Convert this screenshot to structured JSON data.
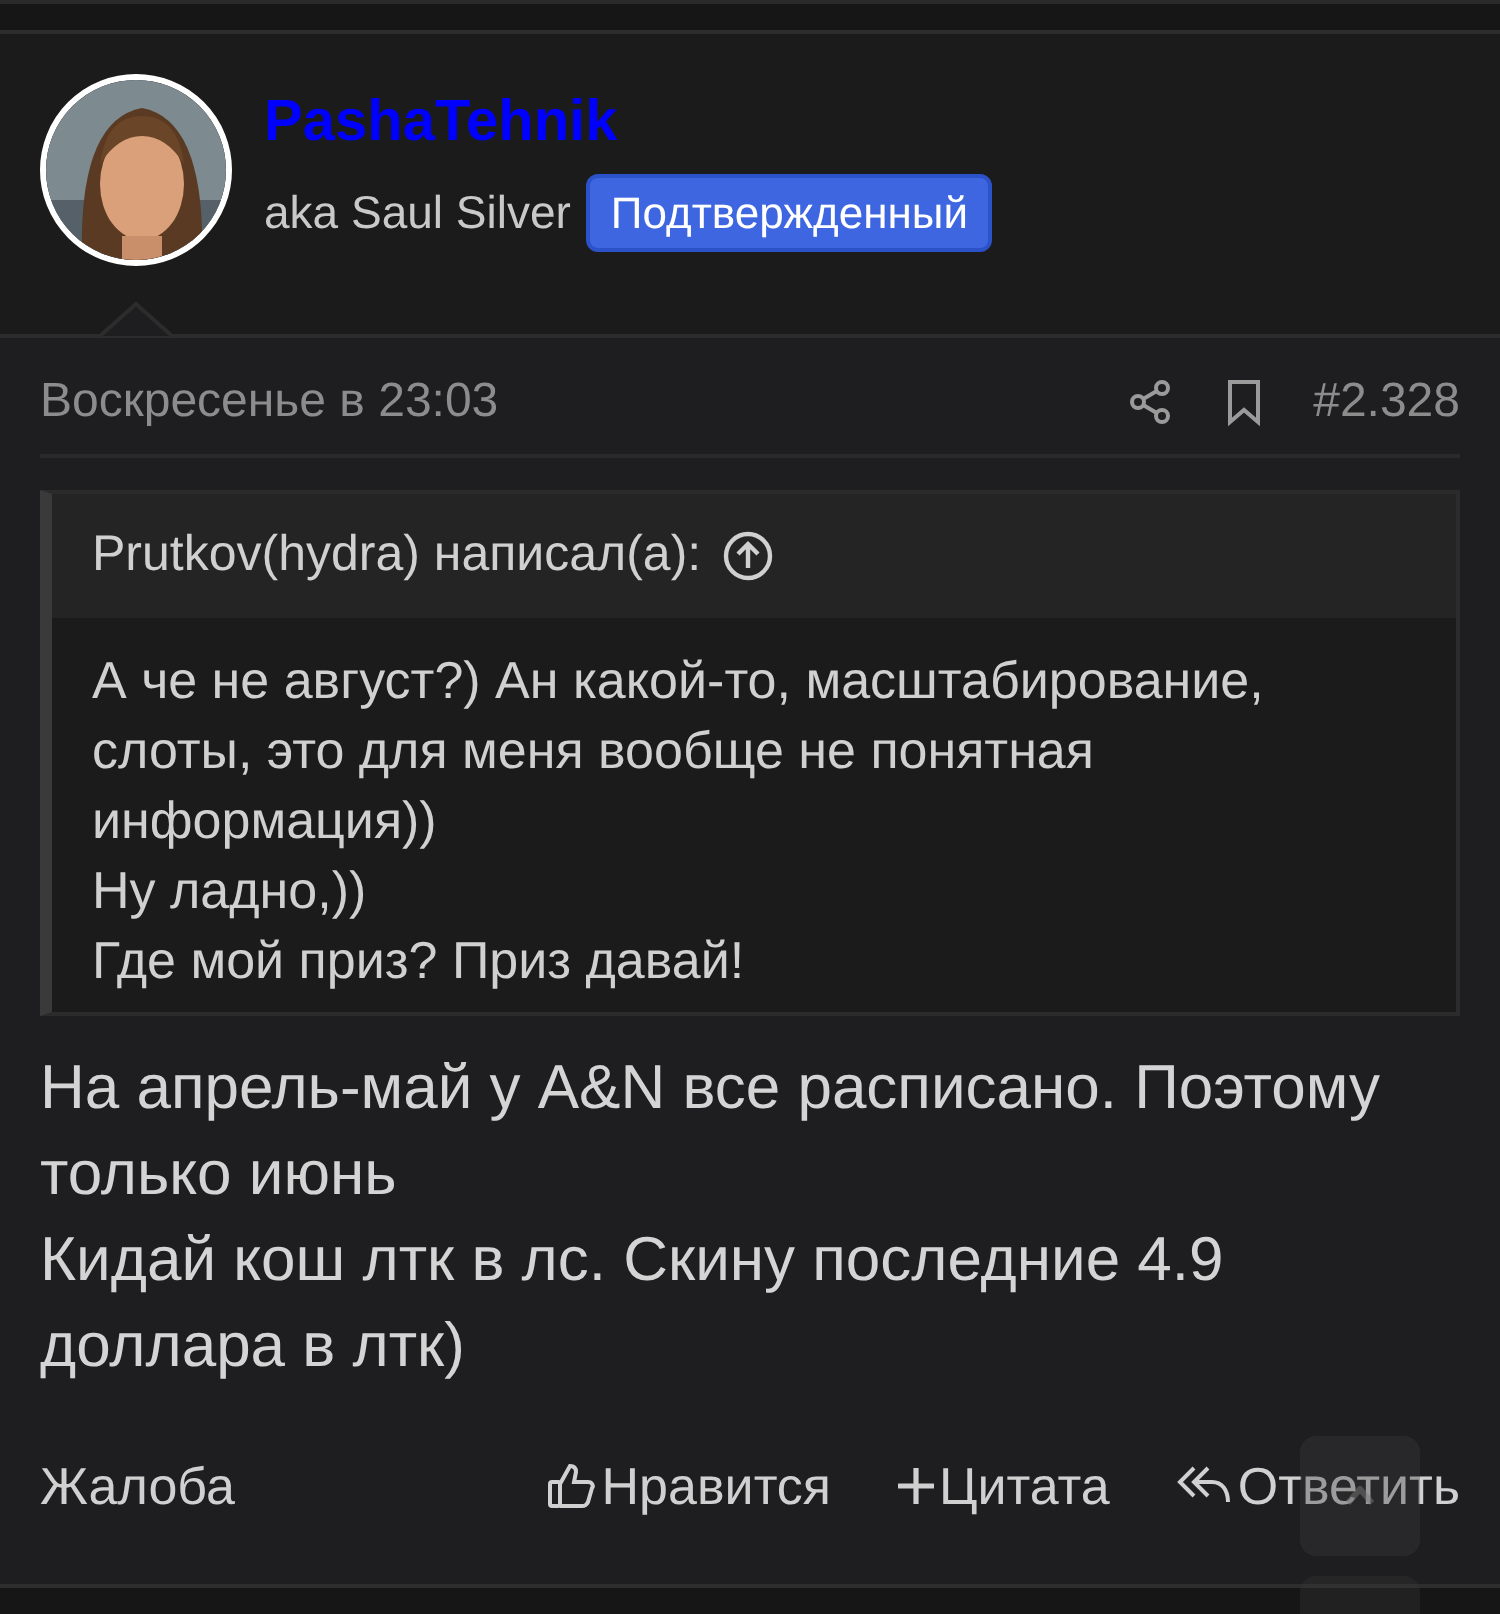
{
  "author": {
    "name": "PashaTehnik",
    "subtitle": "aka Saul Silver",
    "badge": "Подтвержденный"
  },
  "meta": {
    "date": "Воскресенье в 23:03",
    "post_number": "#2.328"
  },
  "quote": {
    "author": "Prutkov(hydra) написал(а):",
    "lines": [
      "А че не август?) Ан какой-то, масштабирование, слоты, это для меня вообще не понятная информация))",
      "Ну ладно,))",
      "Где мой приз? Приз давай!"
    ]
  },
  "body": [
    "На апрель-май у A&N все расписано. Поэтому только июнь",
    "Кидай кош лтк в лс. Скину последние 4.9 доллара в лтк)"
  ],
  "actions": [
    {
      "kind": "report",
      "label": "Жалоба"
    },
    {
      "kind": "like",
      "label": "Нравится"
    },
    {
      "kind": "quote",
      "label": "Цитата"
    },
    {
      "kind": "reply",
      "label": "Ответить"
    }
  ]
}
